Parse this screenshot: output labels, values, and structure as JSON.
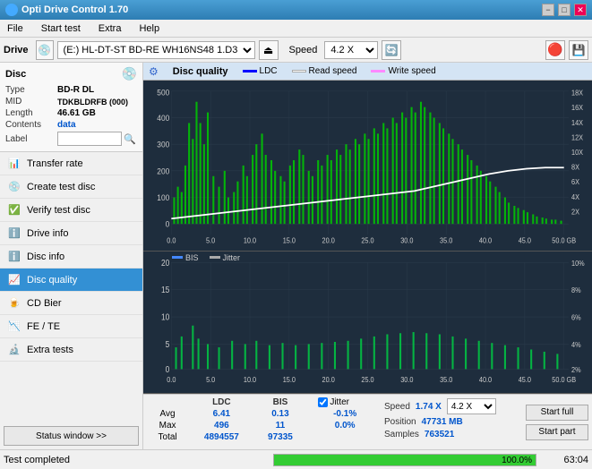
{
  "app": {
    "title": "Opti Drive Control 1.70",
    "icon": "disc"
  },
  "titlebar": {
    "title": "Opti Drive Control 1.70",
    "minimize": "−",
    "maximize": "□",
    "close": "✕"
  },
  "menubar": {
    "items": [
      "File",
      "Start test",
      "Extra",
      "Help"
    ]
  },
  "drive_toolbar": {
    "drive_label": "Drive",
    "drive_value": "(E:)  HL-DT-ST BD-RE  WH16NS48 1.D3",
    "speed_label": "Speed",
    "speed_value": "4.2 X"
  },
  "disc_panel": {
    "title": "Disc",
    "type_label": "Type",
    "type_value": "BD-R DL",
    "mid_label": "MID",
    "mid_value": "TDKBLDRFB (000)",
    "length_label": "Length",
    "length_value": "46.61 GB",
    "contents_label": "Contents",
    "contents_value": "data",
    "label_label": "Label",
    "label_value": ""
  },
  "sidebar_nav": [
    {
      "id": "transfer-rate",
      "label": "Transfer rate",
      "active": false
    },
    {
      "id": "create-test-disc",
      "label": "Create test disc",
      "active": false
    },
    {
      "id": "verify-test-disc",
      "label": "Verify test disc",
      "active": false
    },
    {
      "id": "drive-info",
      "label": "Drive info",
      "active": false
    },
    {
      "id": "disc-info",
      "label": "Disc info",
      "active": false
    },
    {
      "id": "disc-quality",
      "label": "Disc quality",
      "active": true
    },
    {
      "id": "cd-bier",
      "label": "CD Bier",
      "active": false
    },
    {
      "id": "fe-te",
      "label": "FE / TE",
      "active": false
    },
    {
      "id": "extra-tests",
      "label": "Extra tests",
      "active": false
    }
  ],
  "status_window_btn": "Status window >>",
  "chart": {
    "title": "Disc quality",
    "legend": [
      {
        "id": "ldc",
        "label": "LDC",
        "color": "#0000ff"
      },
      {
        "id": "read-speed",
        "label": "Read speed",
        "color": "#ffffff"
      },
      {
        "id": "write-speed",
        "label": "Write speed",
        "color": "#ff00ff"
      }
    ],
    "upper_y_max": 500,
    "upper_y_labels": [
      500,
      400,
      300,
      200,
      100,
      0
    ],
    "upper_y2_labels": [
      "18X",
      "16X",
      "14X",
      "12X",
      "10X",
      "8X",
      "6X",
      "4X",
      "2X"
    ],
    "x_labels": [
      "0.0",
      "5.0",
      "10.0",
      "15.0",
      "20.0",
      "25.0",
      "30.0",
      "35.0",
      "40.0",
      "45.0",
      "50.0 GB"
    ],
    "lower_legend": [
      {
        "id": "bis",
        "label": "BIS",
        "color": "#0055ff"
      },
      {
        "id": "jitter",
        "label": "Jitter",
        "color": "#aaaaaa"
      }
    ],
    "lower_y_max": 20,
    "lower_y_labels": [
      20,
      15,
      10,
      5,
      0
    ],
    "lower_y2_labels": [
      "10%",
      "8%",
      "6%",
      "4%",
      "2%"
    ]
  },
  "stats": {
    "headers": [
      "",
      "LDC",
      "BIS",
      "",
      "Jitter",
      "Speed",
      ""
    ],
    "avg_label": "Avg",
    "avg_ldc": "6.41",
    "avg_bis": "0.13",
    "avg_jitter": "-0.1%",
    "max_label": "Max",
    "max_ldc": "496",
    "max_bis": "11",
    "max_jitter": "0.0%",
    "total_label": "Total",
    "total_ldc": "4894557",
    "total_bis": "97335",
    "speed_label": "Speed",
    "speed_value": "1.74 X",
    "speed_select": "4.2 X",
    "position_label": "Position",
    "position_value": "47731 MB",
    "samples_label": "Samples",
    "samples_value": "763521",
    "start_full_label": "Start full",
    "start_part_label": "Start part",
    "jitter_checked": true,
    "jitter_label": "Jitter"
  },
  "statusbar": {
    "text": "Test completed",
    "progress": 100,
    "time": "63:04"
  }
}
